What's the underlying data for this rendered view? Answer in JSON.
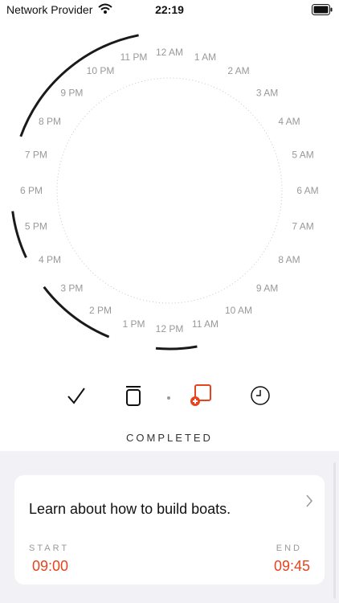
{
  "status_bar": {
    "carrier": "Network Provider",
    "time": "22:19"
  },
  "dial": {
    "hour_labels": [
      "12 AM",
      "1 AM",
      "2 AM",
      "3 AM",
      "4 AM",
      "5 AM",
      "6 AM",
      "7 AM",
      "8 AM",
      "9 AM",
      "10 AM",
      "11 AM",
      "12 PM",
      "1 PM",
      "2 PM",
      "3 PM",
      "4 PM",
      "5 PM",
      "6 PM",
      "7 PM",
      "8 PM",
      "9 PM",
      "10 PM",
      "11 PM"
    ],
    "arc_color": "#1a1a1a",
    "arcs_hours": [
      [
        11.33,
        12.33
      ],
      [
        13.5,
        15.5
      ],
      [
        16.33,
        17.5
      ],
      [
        19.33,
        23.25
      ]
    ]
  },
  "toolbar": {
    "icons": [
      "checkmark-icon",
      "trash-icon",
      "separator-dot-icon",
      "add-task-icon",
      "clock-icon"
    ],
    "accent": "#e5441e"
  },
  "status_label": "COMPLETED",
  "task": {
    "title": "Learn about how to build boats.",
    "start_label": "START",
    "start_time": "09:00",
    "end_label": "END",
    "end_time": "09:45"
  }
}
